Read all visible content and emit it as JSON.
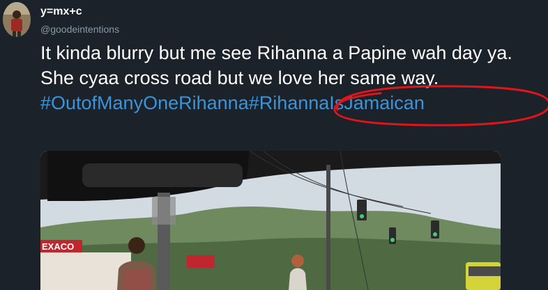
{
  "user": {
    "name": "y=mx+c",
    "handle": "@goodeintentions"
  },
  "tweet": {
    "text_line": "It kinda blurry but me see Rihanna a Papine wah day ya. She cyaa cross road but we love her same way. ",
    "hashtag_1": "#OutofManyOneRihanna",
    "hashtag_2": "#RihannaIsJamaican"
  },
  "photo": {
    "sign_text": "EXACO",
    "annotation_color": "#e0141b"
  },
  "colors": {
    "background": "#1c2229",
    "hashtag": "#3b94d9",
    "handle": "#8899a6"
  }
}
